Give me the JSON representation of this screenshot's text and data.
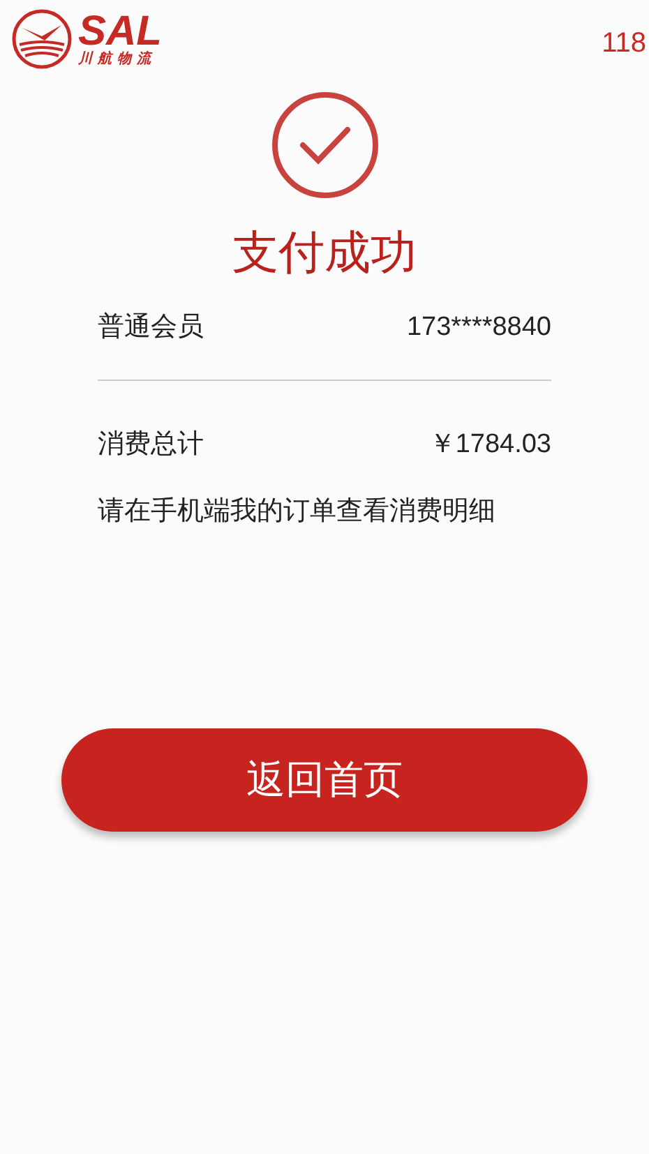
{
  "header": {
    "logo_title": "SAL",
    "logo_subtitle": "川航物流",
    "countdown": "118"
  },
  "status": {
    "title": "支付成功"
  },
  "member": {
    "label": "普通会员",
    "value": "173****8840"
  },
  "total": {
    "label": "消费总计",
    "value": "￥1784.03"
  },
  "note": "请在手机端我的订单查看消费明细",
  "button": {
    "label": "返回首页"
  }
}
